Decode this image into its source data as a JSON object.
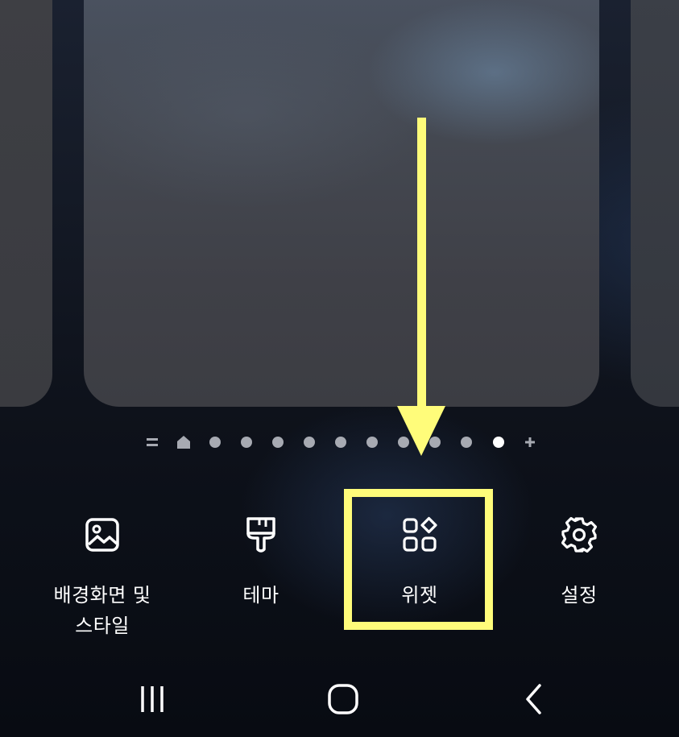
{
  "home_preview": {
    "pages": [
      "left-page",
      "current-page",
      "right-page"
    ]
  },
  "page_indicator": {
    "items": [
      {
        "type": "menu",
        "icon": "menu-icon"
      },
      {
        "type": "home",
        "icon": "home-icon"
      },
      {
        "type": "dot"
      },
      {
        "type": "dot"
      },
      {
        "type": "dot"
      },
      {
        "type": "dot"
      },
      {
        "type": "dot"
      },
      {
        "type": "dot"
      },
      {
        "type": "dot"
      },
      {
        "type": "dot"
      },
      {
        "type": "dot"
      },
      {
        "type": "dot",
        "active": true
      },
      {
        "type": "add",
        "icon": "plus-icon"
      }
    ]
  },
  "bottom_menu": {
    "wallpaper_label": "배경화면 및\n스타일",
    "themes_label": "테마",
    "widgets_label": "위젯",
    "settings_label": "설정"
  },
  "annotation": {
    "highlight_color": "#fffc7a",
    "target": "widgets"
  },
  "navigation_bar": {
    "recent_icon": "recent-apps-icon",
    "home_icon": "home-button-icon",
    "back_icon": "back-icon"
  }
}
